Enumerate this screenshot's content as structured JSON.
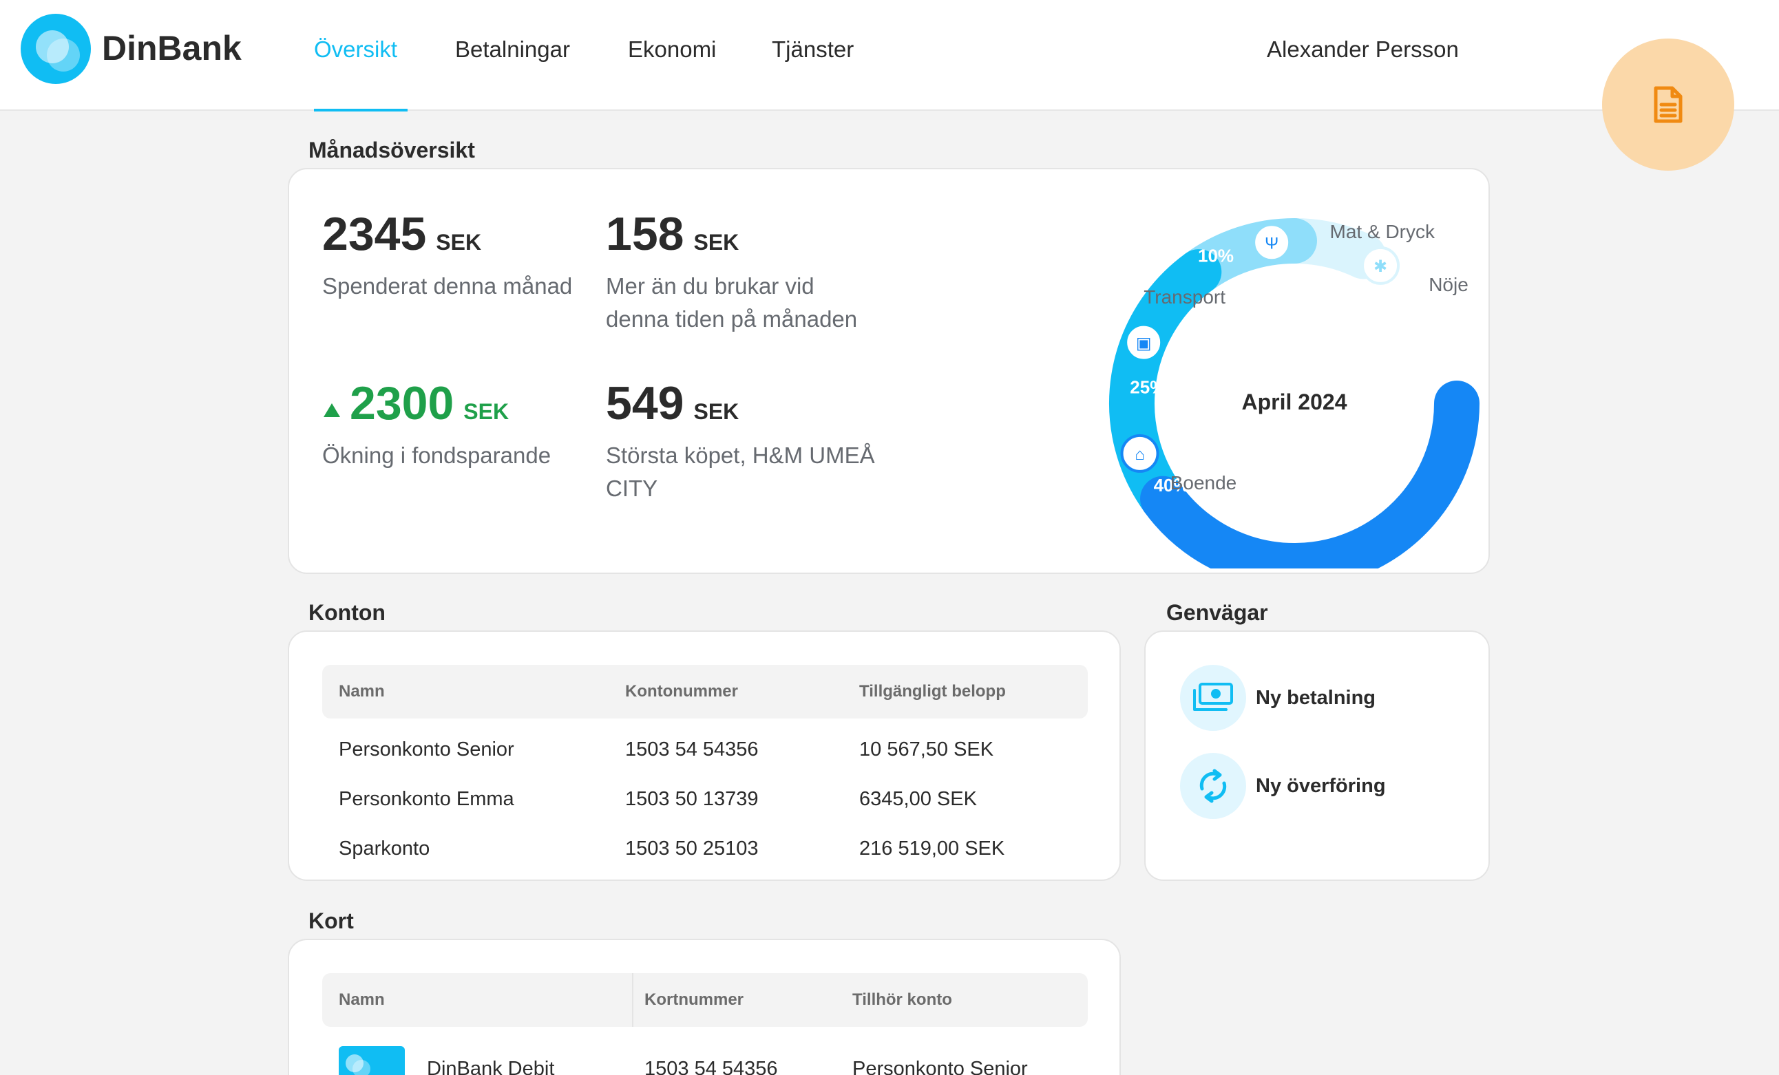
{
  "app": {
    "name": "DinBank"
  },
  "nav": {
    "items": [
      "Översikt",
      "Betalningar",
      "Ekonomi",
      "Tjänster"
    ],
    "active": "Översikt"
  },
  "user": {
    "name": "Alexander Persson"
  },
  "fab": {
    "icon": "document-icon"
  },
  "overview": {
    "title": "Månadsöversikt",
    "stats": [
      {
        "value": "2345",
        "unit": "SEK",
        "label_lines": [
          "Spenderat denna månad"
        ]
      },
      {
        "value": "158",
        "unit": "SEK",
        "label_lines": [
          "Mer än du brukar vid",
          "denna tiden på månaden"
        ]
      },
      {
        "value": "2300",
        "unit": "SEK",
        "label_lines": [
          "Ökning i fondsparande"
        ],
        "trend": "up"
      },
      {
        "value": "549",
        "unit": "SEK",
        "label_lines": [
          "Största köpet, H&M UMEÅ",
          "CITY"
        ]
      }
    ]
  },
  "chart_data": {
    "type": "pie",
    "center_label": "April 2024",
    "slices": [
      {
        "name": "Boende",
        "percent": 40,
        "label": "40%",
        "icon": "home-icon",
        "color": "#1587f5"
      },
      {
        "name": "Transport",
        "percent": 25,
        "label": "25%",
        "icon": "train-icon",
        "color": "#10bdf3"
      },
      {
        "name": "Mat & Dryck",
        "percent": 10,
        "label": "10%",
        "icon": "fork-knife-icon",
        "color": "#8fdefa"
      },
      {
        "name": "Nöje",
        "label": "",
        "icon": "ferris-wheel-icon",
        "color": "#daf4fd"
      }
    ]
  },
  "accounts": {
    "title": "Konton",
    "columns": [
      "Namn",
      "Kontonummer",
      "Tillgängligt belopp"
    ],
    "rows": [
      [
        "Personkonto Senior",
        "1503 54 54356",
        "10 567,50 SEK"
      ],
      [
        "Personkonto Emma",
        "1503 50 13739",
        "6345,00 SEK"
      ],
      [
        "Sparkonto",
        "1503 50 25103",
        "216 519,00 SEK"
      ]
    ]
  },
  "shortcuts": {
    "title": "Genvägar",
    "items": [
      {
        "label": "Ny betalning",
        "icon": "money-icon"
      },
      {
        "label": "Ny överföring",
        "icon": "refresh-icon"
      }
    ]
  },
  "cards": {
    "title": "Kort",
    "columns": [
      "Namn",
      "Kortnummer",
      "Tillhör konto"
    ],
    "rows": [
      [
        "DinBank Debit",
        "1503 54 54356",
        "Personkonto Senior"
      ]
    ]
  },
  "colors": {
    "accent": "#10bdf3",
    "positive": "#1fa04a",
    "fab": "#fbd8a9"
  }
}
